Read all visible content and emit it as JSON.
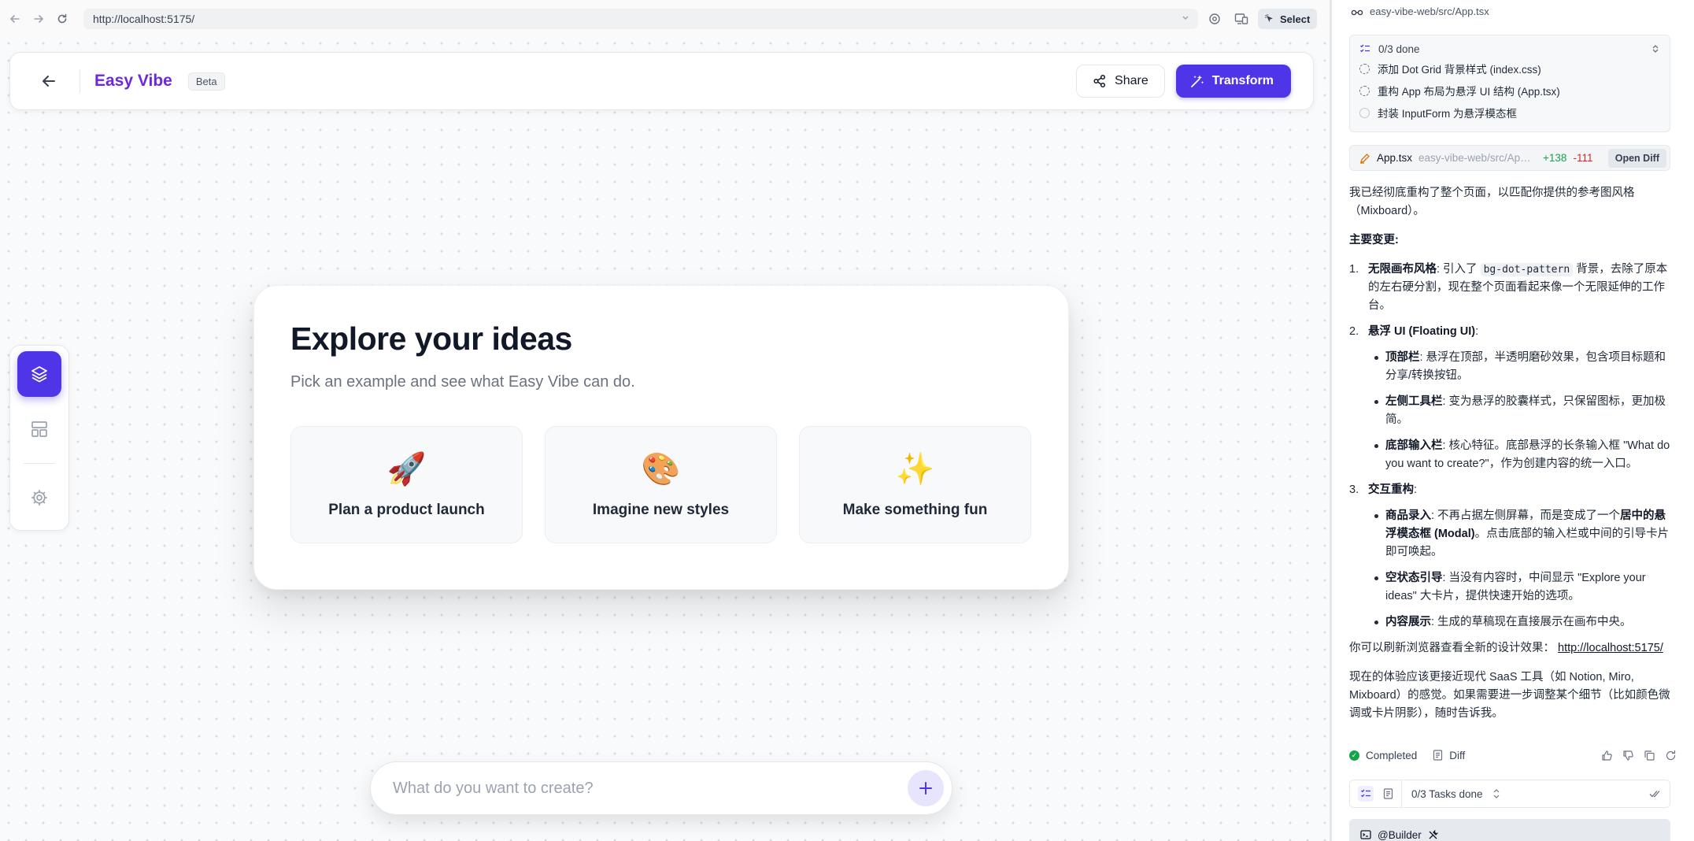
{
  "browser": {
    "url": "http://localhost:5175/",
    "select_label": "Select"
  },
  "header": {
    "brand": "Easy Vibe",
    "badge": "Beta",
    "share_label": "Share",
    "transform_label": "Transform"
  },
  "explore": {
    "title": "Explore your ideas",
    "subtitle": "Pick an example and see what Easy Vibe can do.",
    "examples": [
      {
        "emoji": "🚀",
        "label": "Plan a product launch"
      },
      {
        "emoji": "🎨",
        "label": "Imagine new styles"
      },
      {
        "emoji": "✨",
        "label": "Make something fun"
      }
    ]
  },
  "prompt": {
    "placeholder": "What do you want to create?"
  },
  "panel": {
    "file_path": "easy-vibe-web/src/App.tsx",
    "todo": {
      "summary": "0/3 done",
      "items": [
        "添加 Dot Grid 背景样式 (index.css)",
        "重构 App 布局为悬浮 UI 结构 (App.tsx)",
        "封装 InputForm 为悬浮模态框"
      ]
    },
    "diff": {
      "file": "App.tsx",
      "path": "easy-vibe-web/src/App.tsx",
      "added": "+138",
      "removed": "-111",
      "open_label": "Open Diff"
    },
    "message": {
      "intro": "我已经彻底重构了整个页面，以匹配你提供的参考图风格（Mixboard）。",
      "changes_heading": "主要变更:",
      "item1_num": "1.",
      "item1_title": "无限画布风格",
      "item1_pre": ": 引入了 ",
      "item1_code": "bg-dot-pattern",
      "item1_post": " 背景，去除了原本的左右硬分割，现在整个页面看起来像一个无限延伸的工作台。",
      "item2_num": "2.",
      "item2_title": "悬浮 UI (Floating UI)",
      "item2_colon": ":",
      "item2_b1_title": "顶部栏",
      "item2_b1_text": ": 悬浮在顶部，半透明磨砂效果，包含项目标题和分享/转换按钮。",
      "item2_b2_title": "左侧工具栏",
      "item2_b2_text": ": 变为悬浮的胶囊样式，只保留图标，更加极简。",
      "item2_b3_title": "底部输入栏",
      "item2_b3_text": ": 核心特征。底部悬浮的长条输入框 \"What do you want to create?\"，作为创建内容的统一入口。",
      "item3_num": "3.",
      "item3_title": "交互重构",
      "item3_colon": ":",
      "item3_b1_title": "商品录入",
      "item3_b1_text1": ": 不再占据左侧屏幕，而是变成了一个",
      "item3_b1_bold": "居中的悬浮模态框 (Modal)",
      "item3_b1_text2": "。点击底部的输入栏或中间的引导卡片即可唤起。",
      "item3_b2_title": "空状态引导",
      "item3_b2_text": ": 当没有内容时，中间显示 \"Explore your ideas\" 大卡片，提供快速开始的选项。",
      "item3_b3_title": "内容展示",
      "item3_b3_text": ": 生成的草稿现在直接展示在画布中央。",
      "refresh_text": "你可以刷新浏览器查看全新的设计效果：",
      "refresh_link": "http://localhost:5175/",
      "closing": "现在的体验应该更接近现代 SaaS 工具（如 Notion, Miro, Mixboard）的感觉。如果需要进一步调整某个细节（比如颜色微调或卡片阴影），随时告诉我。"
    },
    "status": {
      "completed_label": "Completed",
      "diff_label": "Diff"
    },
    "tasks": {
      "summary": "0/3 Tasks done"
    },
    "builder": {
      "label": "@Builder"
    }
  },
  "colors": {
    "accent": "#4f35e8",
    "brand": "#6d28d9",
    "added": "#16a34a",
    "removed": "#dc2626"
  }
}
